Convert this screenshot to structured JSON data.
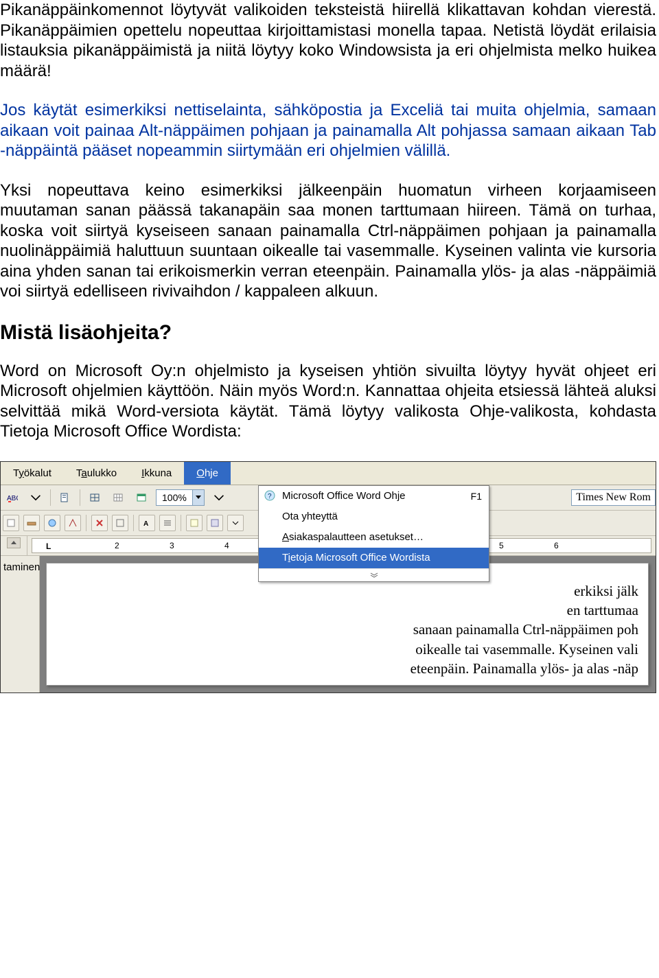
{
  "body": {
    "p1": "Pikanäppäinkomennot löytyvät valikoiden teksteistä hiirellä klikattavan kohdan vierestä. Pikanäppäimien opettelu nopeuttaa kirjoittamistasi monella tapaa. Netistä löydät erilaisia listauksia pikanäppäimistä ja niitä löytyy koko Windowsista ja eri ohjelmista melko huikea määrä!",
    "p2": "Jos käytät esimerkiksi nettiselainta, sähköpostia ja Exceliä tai muita ohjelmia, samaan aikaan voit painaa Alt-näppäimen pohjaan ja painamalla Alt pohjassa samaan aikaan Tab -näppäintä pääset nopeammin siirtymään eri ohjelmien välillä.",
    "p3": "Yksi nopeuttava keino esimerkiksi jälkeenpäin huomatun virheen korjaamiseen muutaman sanan päässä takanapäin saa monen tarttumaan hiireen. Tämä on turhaa, koska voit siirtyä kyseiseen sanaan painamalla Ctrl-näppäimen pohjaan ja painamalla nuolinäppäimiä haluttuun suuntaan oikealle tai vasemmalle. Kyseinen valinta vie kursoria aina yhden sanan tai erikoismerkin verran eteenpäin. Painamalla ylös- ja alas -näppäimiä voi siirtyä edelliseen rivivaihdon / kappaleen alkuun.",
    "h2": "Mistä lisäohjeita?",
    "p4": "Word on Microsoft Oy:n ohjelmisto ja kyseisen yhtiön sivuilta löytyy hyvät ohjeet eri Microsoft ohjelmien käyttöön. Näin myös Word:n. Kannattaa ohjeita etsiessä lähteä aluksi selvittää mikä Word-versiota käytät. Tämä löytyy valikosta Ohje-valikosta, kohdasta Tietoja Microsoft Office Wordista:"
  },
  "screenshot": {
    "menubar": {
      "tools": "Työkalut",
      "table": "Taulukko",
      "window": "Ikkuna",
      "help": "Ohje",
      "tools_u": "y",
      "table_u": "a",
      "window_u": "I",
      "help_u": "O"
    },
    "toolbar": {
      "zoom": "100%",
      "font": "Times New Rom"
    },
    "help_menu": {
      "item1": "Microsoft Office Word Ohje",
      "item1_sc": "F1",
      "item2": "Ota yhteyttä",
      "item3_pre": "Asiakaspalautteen asetukset…",
      "item3_u": "A",
      "item4_pre": "Tietoja Microsoft Office Wordista",
      "item4_u": "i"
    },
    "ruler": {
      "marker": "L",
      "n2": "2",
      "n3": "3",
      "n4": "4",
      "n5": "5",
      "n6": "6"
    },
    "left_label": "taminen",
    "doc_lines": {
      "l1": "erkiksi jälk",
      "l2": "en tarttumaa",
      "l3": "sanaan painamalla Ctrl-näppäimen poh",
      "l4": "oikealle tai vasemmalle. Kyseinen vali",
      "l5": "eteenpäin. Painamalla ylös- ja alas -näp"
    }
  }
}
